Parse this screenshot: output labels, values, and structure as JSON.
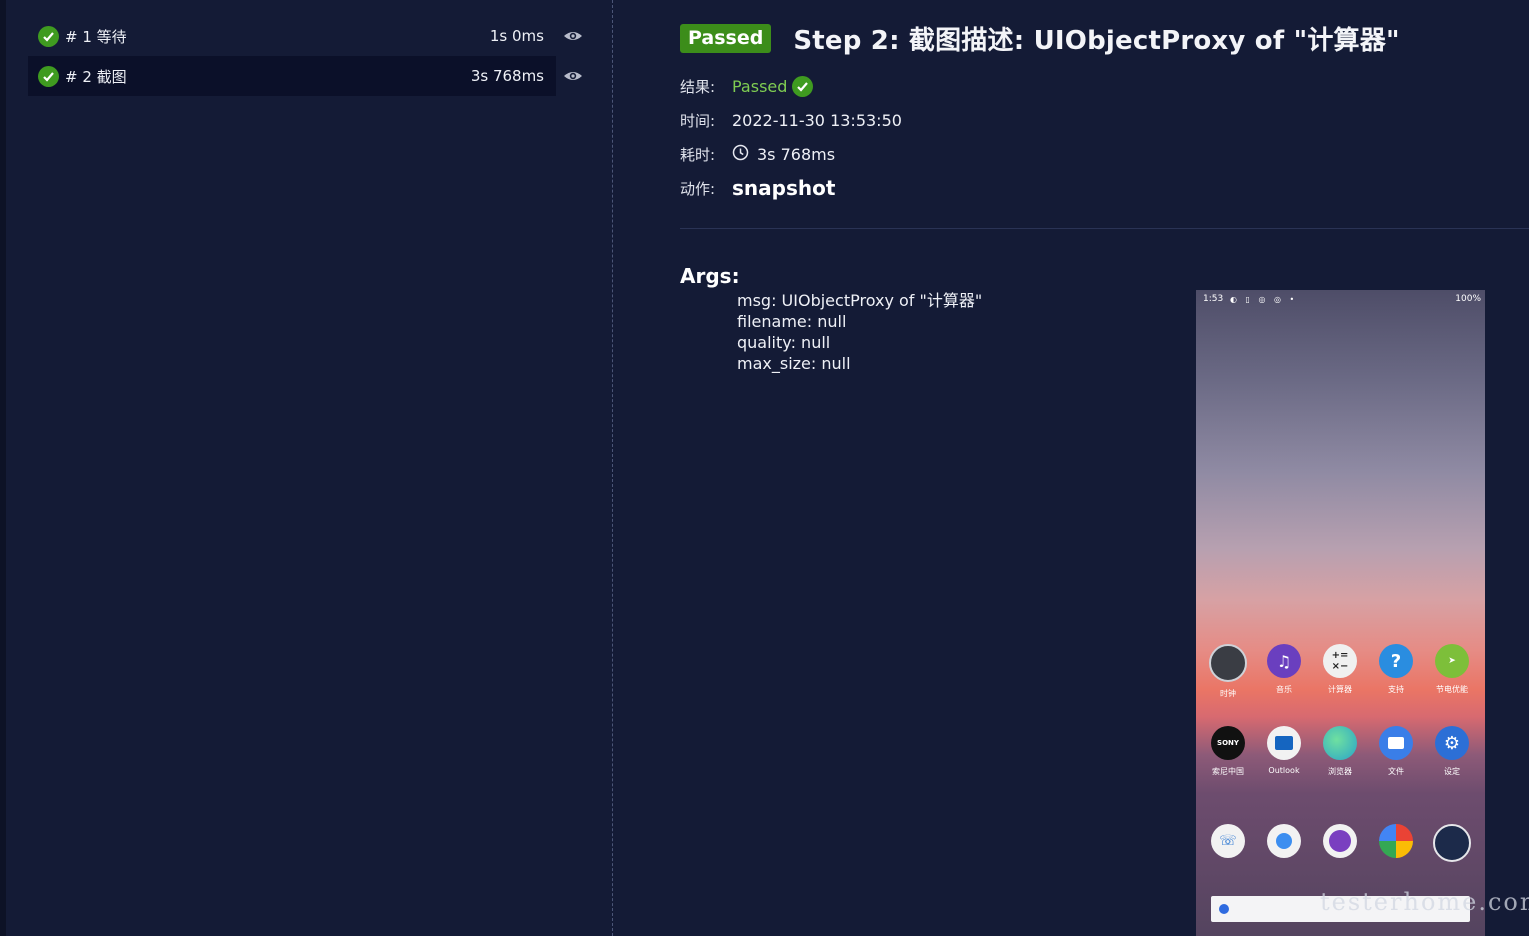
{
  "steps": [
    {
      "label": "# 1 等待",
      "duration": "1s 0ms",
      "active": false
    },
    {
      "label": "# 2 截图",
      "duration": "3s 768ms",
      "active": true
    }
  ],
  "detail": {
    "badge": "Passed",
    "title": "Step 2: 截图描述: UIObjectProxy of \"计算器\"",
    "result_label": "结果:",
    "result_value": "Passed",
    "time_label": "时间:",
    "time_value": "2022-11-30 13:53:50",
    "duration_label": "耗时:",
    "duration_value": "3s 768ms",
    "action_label": "动作:",
    "action_value": "snapshot",
    "args_title": "Args:",
    "args": [
      "msg: UIObjectProxy of \"计算器\"",
      "filename: null",
      "quality: null",
      "max_size: null"
    ]
  },
  "screenshot": {
    "status_time": "1:53",
    "status_battery": "100%",
    "status_icons": "◐ ▯ ◎ ◎ •",
    "row1": [
      {
        "label": "时钟",
        "icon": "clock-icon",
        "color": "#3a3d44"
      },
      {
        "label": "音乐",
        "icon": "music-icon",
        "color": "#6a3fbf"
      },
      {
        "label": "计算器",
        "icon": "calculator-icon",
        "color": "#f0f0f0"
      },
      {
        "label": "支持",
        "icon": "help-icon",
        "color": "#2a8de0"
      },
      {
        "label": "节电优能",
        "icon": "battery-saver-icon",
        "color": "#7dbf3a"
      }
    ],
    "row2": [
      {
        "label": "索尼中国",
        "icon": "sony-icon",
        "color": "#111111",
        "text": "SONY"
      },
      {
        "label": "Outlook",
        "icon": "outlook-icon",
        "color": "#f2f2f2"
      },
      {
        "label": "浏览器",
        "icon": "globe-icon",
        "color": "#2aa4c8"
      },
      {
        "label": "文件",
        "icon": "folder-icon",
        "color": "#3a7ee8"
      },
      {
        "label": "设定",
        "icon": "settings-icon",
        "color": "#2c6fd6"
      }
    ],
    "row3": [
      {
        "label": "",
        "icon": "phone-icon",
        "color": "#f2f2f2"
      },
      {
        "label": "",
        "icon": "messages-icon",
        "color": "#f2f2f2"
      },
      {
        "label": "",
        "icon": "contacts-icon",
        "color": "#f2f2f2"
      },
      {
        "label": "",
        "icon": "photos-icon",
        "color": "#f2f2f2"
      },
      {
        "label": "",
        "icon": "camera-icon",
        "color": "#1c2a4a"
      }
    ]
  },
  "watermark": "testerhome.com",
  "colors": {
    "accent_green": "#3c8d1a",
    "passed_text": "#7fcd52",
    "background": "#141b36"
  }
}
